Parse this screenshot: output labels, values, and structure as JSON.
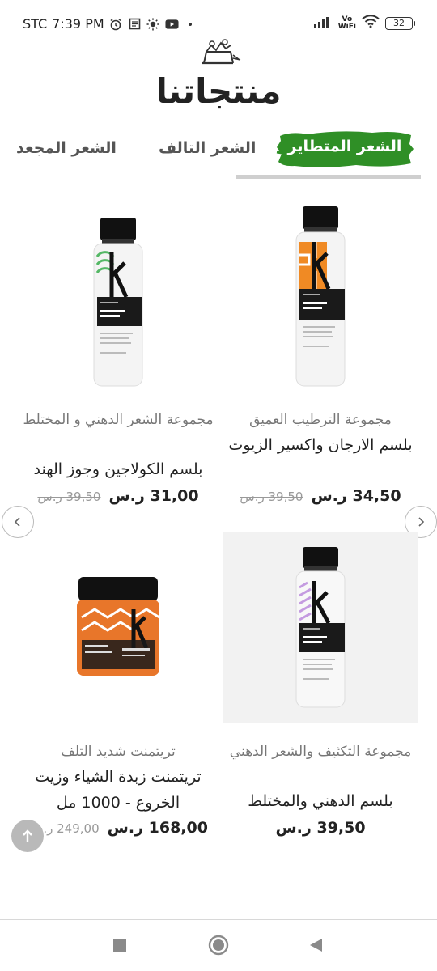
{
  "status_bar": {
    "carrier": "STC",
    "time": "7:39 PM",
    "volte_line1": "Vo",
    "volte_line2": "WiFi",
    "battery": "32"
  },
  "header": {
    "title": "منتجاتنا"
  },
  "tabs": [
    {
      "label": "الشعر المتطاير",
      "active": true
    },
    {
      "label": "الشعر التالف",
      "active": false
    },
    {
      "label": "الشعر المجعد",
      "active": false
    }
  ],
  "products": [
    {
      "category": "مجموعة الترطيب العميق",
      "name": "بلسم الارجان واكسير الزيوت",
      "price": "34,50 ر.س",
      "old_price": "39,50 ر.س",
      "accent": "#f08a24"
    },
    {
      "category": "مجموعة الشعر الدهني و المختلط",
      "name": "بلسم الكولاجين وجوز الهند",
      "price": "31,00 ر.س",
      "old_price": "39,50 ر.س",
      "accent": "#55b866"
    },
    {
      "category": "مجموعة التكثيف والشعر الدهني",
      "name": "بلسم الدهني والمختلط",
      "price": "39,50 ر.س",
      "old_price": "",
      "accent": "#c49be0"
    },
    {
      "category": "تريتمنت شديد التلف",
      "name": "تريتمنت زبدة الشياء وزيت الخروع - 1000 مل",
      "price": "168,00 ر.س",
      "old_price": "249,00 ر.س",
      "accent": "#e8762a"
    }
  ],
  "colors": {
    "tab_active_bg": "#2f8f26",
    "text_dark": "#222222",
    "text_muted": "#777777"
  },
  "icons": {
    "status": [
      "alarm-icon",
      "notes-icon",
      "brightness-icon",
      "youtube-icon",
      "signal-icon",
      "wifi-icon",
      "battery-icon"
    ],
    "nav": [
      "recent-apps-icon",
      "home-icon",
      "back-icon"
    ]
  }
}
